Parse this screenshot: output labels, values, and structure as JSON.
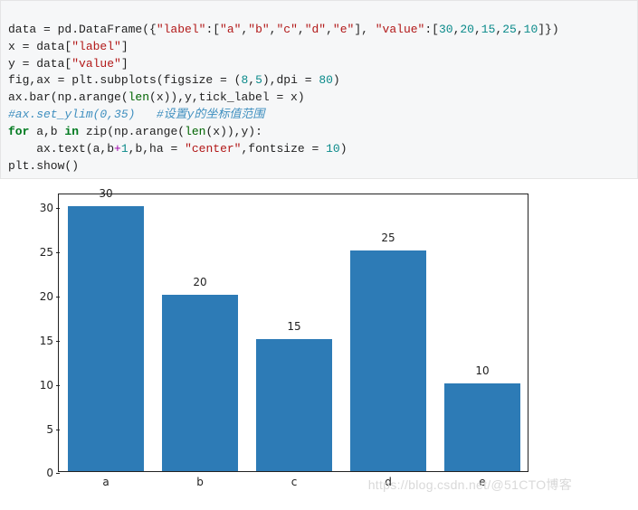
{
  "code": {
    "l1_a": "data = pd.DataFrame({",
    "l1_k1": "\"label\"",
    "l1_c": ":[",
    "l1_v1": "\"a\"",
    "l1_v2": "\"b\"",
    "l1_v3": "\"c\"",
    "l1_v4": "\"d\"",
    "l1_v5": "\"e\"",
    "l1_d": "], ",
    "l1_k2": "\"value\"",
    "l1_e": ":[",
    "l1_n1": "30",
    "l1_n2": "20",
    "l1_n3": "15",
    "l1_n4": "25",
    "l1_n5": "10",
    "l1_f": "]})",
    "l2_a": "x = data[",
    "l2_k": "\"label\"",
    "l2_b": "]",
    "l3_a": "y = data[",
    "l3_k": "\"value\"",
    "l3_b": "]",
    "l4_a": "fig,ax = plt.subplots(figsize = (",
    "l4_n1": "8",
    "l4_n2": "5",
    "l4_b": "),dpi = ",
    "l4_n3": "80",
    "l4_c": ")",
    "l5_a": "ax.bar(np.arange(",
    "l5_len": "len",
    "l5_b": "(x)),y,tick_label = x)",
    "l6": "#ax.set_ylim(0,35)   #设置y的坐标值范围",
    "l7_for": "for",
    "l7_a": " a,b ",
    "l7_in": "in",
    "l7_b": " zip(np.arange(",
    "l7_len": "len",
    "l7_c": "(x)),y):",
    "l8_a": "    ax.text(a,b",
    "l8_op": "+",
    "l8_n": "1",
    "l8_b": ",b,ha = ",
    "l8_s": "\"center\"",
    "l8_c": ",fontsize = ",
    "l8_n2": "10",
    "l8_d": ")",
    "l9": "plt.show()"
  },
  "chart_data": {
    "type": "bar",
    "categories": [
      "a",
      "b",
      "c",
      "d",
      "e"
    ],
    "values": [
      30,
      20,
      15,
      25,
      10
    ],
    "bar_labels": [
      "30",
      "20",
      "15",
      "25",
      "10"
    ],
    "ylim": [
      0,
      31.5
    ],
    "yticks": [
      0,
      5,
      10,
      15,
      20,
      25,
      30
    ],
    "ytick_labels": [
      "0",
      "5",
      "10",
      "15",
      "20",
      "25",
      "30"
    ],
    "bar_color": "#2d7bb6",
    "title": "",
    "xlabel": "",
    "ylabel": ""
  },
  "watermark": "https://blog.csdn.net/@51CTO博客"
}
